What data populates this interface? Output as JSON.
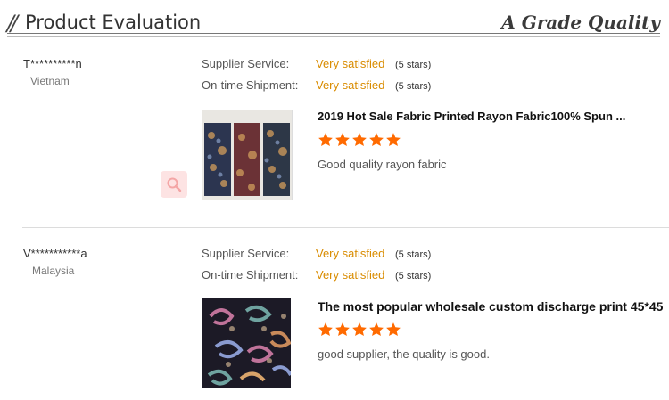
{
  "header": {
    "slash": "//",
    "title": "Product Evaluation",
    "right_label": "A Grade Quality"
  },
  "colors": {
    "accent": "#d98c00",
    "star": "#ff6a00",
    "zoom_bg": "#fde3e3"
  },
  "reviews": [
    {
      "user": "T**********n",
      "country": "Vietnam",
      "ratings": [
        {
          "label": "Supplier Service:",
          "value": "Very satisfied",
          "stars": "(5 stars)"
        },
        {
          "label": "On-time Shipment:",
          "value": "Very satisfied",
          "stars": "(5 stars)"
        }
      ],
      "product_title": "2019 Hot Sale Fabric Printed Rayon Fabric100% Spun ...",
      "product_rating": 5,
      "comment": "Good quality rayon fabric",
      "icon": "search-icon"
    },
    {
      "user": "V***********a",
      "country": "Malaysia",
      "ratings": [
        {
          "label": "Supplier Service:",
          "value": "Very satisfied",
          "stars": "(5 stars)"
        },
        {
          "label": "On-time Shipment:",
          "value": "Very satisfied",
          "stars": "(5 stars)"
        }
      ],
      "product_title": "The most popular wholesale custom discharge print 45*45",
      "product_rating": 5,
      "comment": "good supplier, the quality is good."
    }
  ]
}
